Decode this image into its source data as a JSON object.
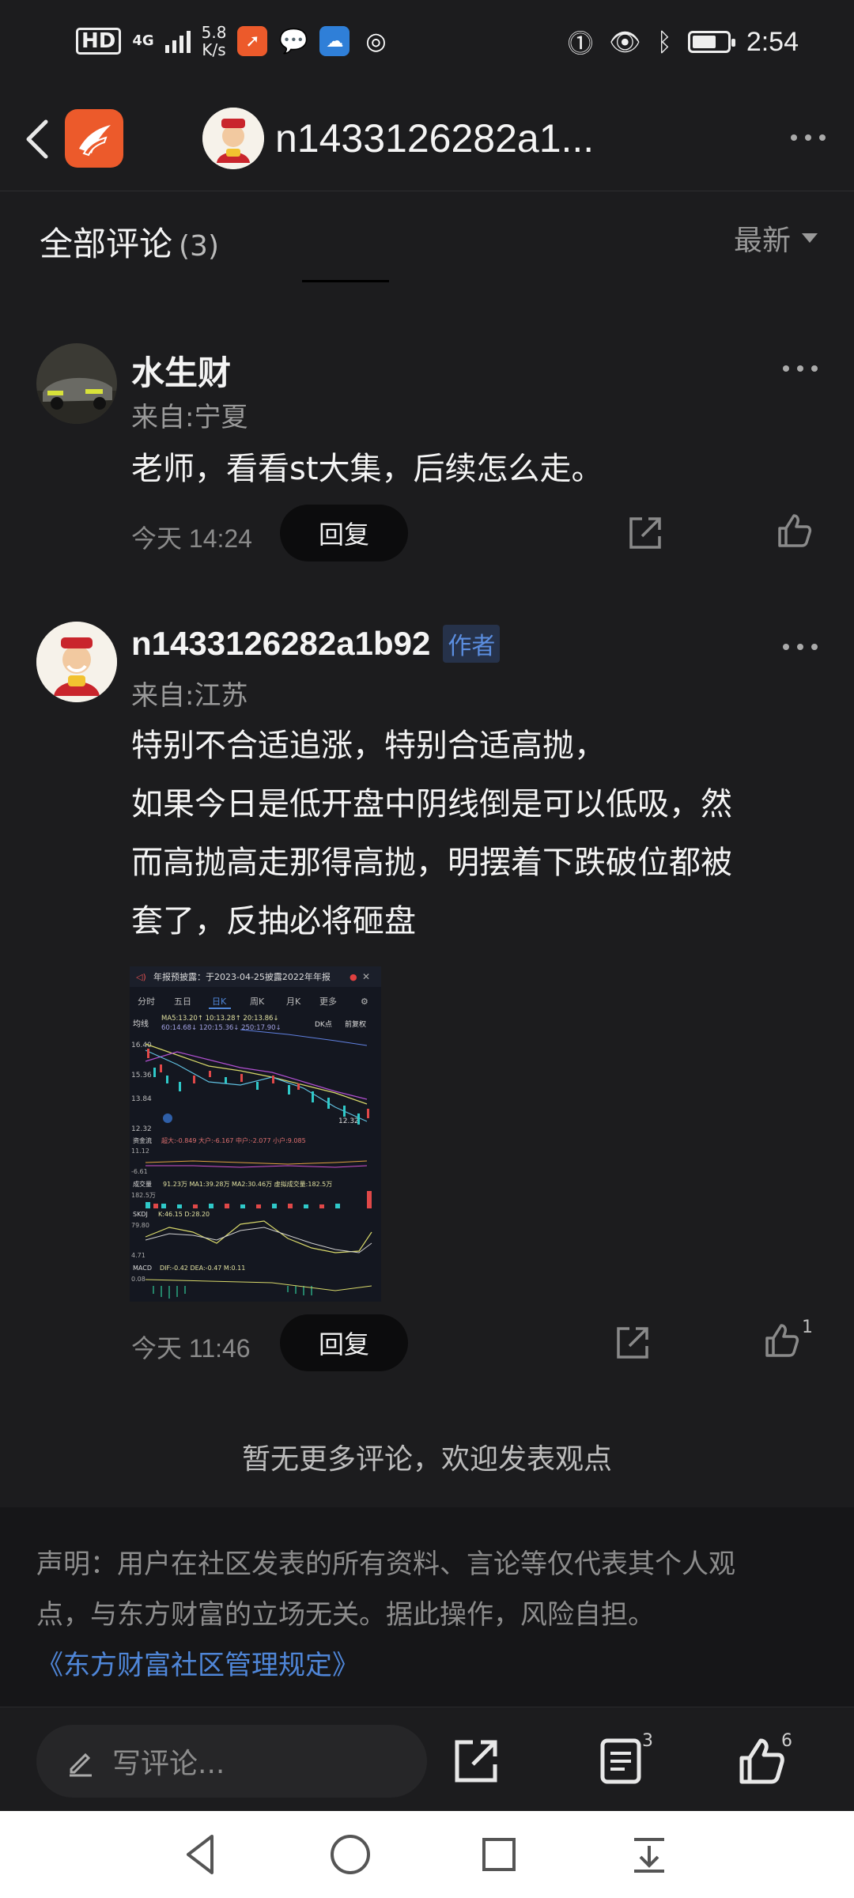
{
  "status_bar": {
    "hd": "HD",
    "signal": "4G",
    "speed_value": "5.8",
    "speed_unit": "K/s",
    "time": "2:54"
  },
  "header": {
    "title": "n1433126282a1..."
  },
  "comments_section": {
    "title": "全部评论",
    "count": "(3)",
    "sort_label": "最新"
  },
  "comments": [
    {
      "name": "水生财",
      "from": "来自:宁夏",
      "text_lines": [
        "老师，看看st大集，后续怎么走。"
      ],
      "time": "今天 14:24",
      "reply_label": "回复"
    },
    {
      "name": "n1433126282a1b92",
      "badge": "作者",
      "from": "来自:江苏",
      "text_lines": [
        "特别不合适追涨，特别合适高抛，",
        "如果今日是低开盘中阴线倒是可以低吸，然",
        "而高抛高走那得高抛，明摆着下跌破位都被",
        "套了，反抽必将砸盘"
      ],
      "time": "今天 11:46",
      "reply_label": "回复",
      "like_count": "1",
      "image": {
        "notice": "年报预披露：于2023-04-25披露2022年年报",
        "tabs": [
          "分时",
          "五日",
          "日K",
          "周K",
          "月K",
          "更多"
        ],
        "ma_line1": "MA5:13.20↑  10:13.28↑  20:13.86↓",
        "ma_line2": "60:14.68↓  120:15.36↓  250:17.90↓",
        "left_label": "均线",
        "dk_label": "DK点",
        "fq_label": "前复权",
        "price_high": "16.40",
        "price_mid": "15.36",
        "price_low": "13.84",
        "price_min": "12.32",
        "price_last": "12.32",
        "fund_label": "资金流",
        "fund_values": "超大:-0.849  大户:-6.167  中户:-2.077  小户:9.085",
        "vol_label": "成交量",
        "vol_values": "91.23万  MA1:39.28万  MA2:30.46万  虚拟成交量:182.5万",
        "vol_scale": "182.5万",
        "kdj_label": "SKDJ",
        "kdj_values": "K:46.15  D:28.20",
        "kdj_scale_1": "79.80",
        "kdj_scale_2": "4.71",
        "macd_label": "MACD",
        "macd_values": "DIF:-0.42  DEA:-0.47  M:0.11",
        "macd_scale": "0.08",
        "fund_scale_1": "11.12",
        "fund_scale_2": "-6.61"
      }
    }
  ],
  "no_more": "暂无更多评论，欢迎发表观点",
  "disclaimer": {
    "line1": "声明：用户在社区发表的所有资料、言论等仅代表其个人观",
    "line2": "点，与东方财富的立场无关。据此操作，风险自担。",
    "link": "《东方财富社区管理规定》"
  },
  "bottom_bar": {
    "write_placeholder": "写评论...",
    "comment_count": "3",
    "like_count": "6"
  },
  "colors": {
    "background": "#1c1c1e",
    "accent_link": "#4f86d8",
    "brand_orange": "#ec5a2b"
  }
}
